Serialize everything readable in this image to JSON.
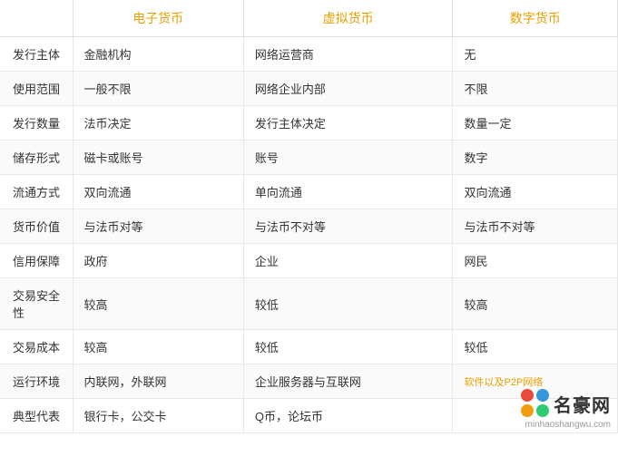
{
  "table": {
    "headers": [
      "",
      "电子货币",
      "虚拟货币",
      "数字货币"
    ],
    "rows": [
      {
        "label": "发行主体",
        "col1": "金融机构",
        "col2": "网络运营商",
        "col3": "无"
      },
      {
        "label": "使用范围",
        "col1": "一般不限",
        "col2": "网络企业内部",
        "col3": "不限"
      },
      {
        "label": "发行数量",
        "col1": "法币决定",
        "col2": "发行主体决定",
        "col3": "数量一定"
      },
      {
        "label": "储存形式",
        "col1": "磁卡或账号",
        "col2": "账号",
        "col3": "数字"
      },
      {
        "label": "流通方式",
        "col1": "双向流通",
        "col2": "单向流通",
        "col3": "双向流通"
      },
      {
        "label": "货币价值",
        "col1": "与法币对等",
        "col2": "与法币不对等",
        "col3": "与法币不对等"
      },
      {
        "label": "信用保障",
        "col1": "政府",
        "col2": "企业",
        "col3": "网民"
      },
      {
        "label": "交易安全性",
        "col1": "较高",
        "col2": "较低",
        "col3": "较高"
      },
      {
        "label": "交易成本",
        "col1": "较高",
        "col2": "较低",
        "col3": "较低"
      },
      {
        "label": "运行环境",
        "col1": "内联网，外联网",
        "col2": "企业服务器与互联网",
        "col3": ""
      },
      {
        "label": "典型代表",
        "col1": "银行卡，公交卡",
        "col2": "Q币，论坛币",
        "col3": ""
      }
    ],
    "watermark": {
      "text": "名豪网",
      "subtext": "minhaoshangwu.com"
    }
  }
}
